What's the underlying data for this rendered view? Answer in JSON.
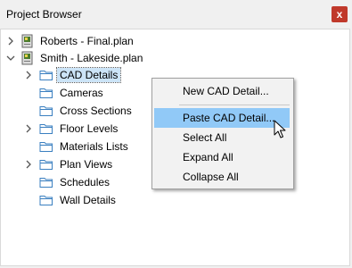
{
  "window": {
    "title": "Project Browser",
    "close_glyph": "x",
    "accent_close": "#c0392b"
  },
  "tree": {
    "projects": [
      {
        "label": "Roberts - Final.plan",
        "expanded": false,
        "icon": "plan-file-icon"
      },
      {
        "label": "Smith - Lakeside.plan",
        "expanded": true,
        "icon": "plan-file-icon"
      }
    ],
    "folders": [
      {
        "label": "CAD Details",
        "expandable": true,
        "selected": true
      },
      {
        "label": "Cameras",
        "expandable": false,
        "selected": false
      },
      {
        "label": "Cross Sections",
        "expandable": false,
        "selected": false
      },
      {
        "label": "Floor Levels",
        "expandable": true,
        "selected": false
      },
      {
        "label": "Materials Lists",
        "expandable": false,
        "selected": false
      },
      {
        "label": "Plan Views",
        "expandable": true,
        "selected": false
      },
      {
        "label": "Schedules",
        "expandable": false,
        "selected": false
      },
      {
        "label": "Wall Details",
        "expandable": false,
        "selected": false
      }
    ]
  },
  "context_menu": {
    "items": [
      {
        "label": "New CAD Detail...",
        "highlighted": false
      },
      {
        "label": "Paste CAD Detail...",
        "highlighted": true
      },
      {
        "label": "Select All",
        "highlighted": false
      },
      {
        "label": "Expand All",
        "highlighted": false
      },
      {
        "label": "Collapse All",
        "highlighted": false
      }
    ],
    "highlight_color": "#91c9f7"
  },
  "colors": {
    "selection": "#cce4f7",
    "folder_outline": "#3a7fc0"
  }
}
